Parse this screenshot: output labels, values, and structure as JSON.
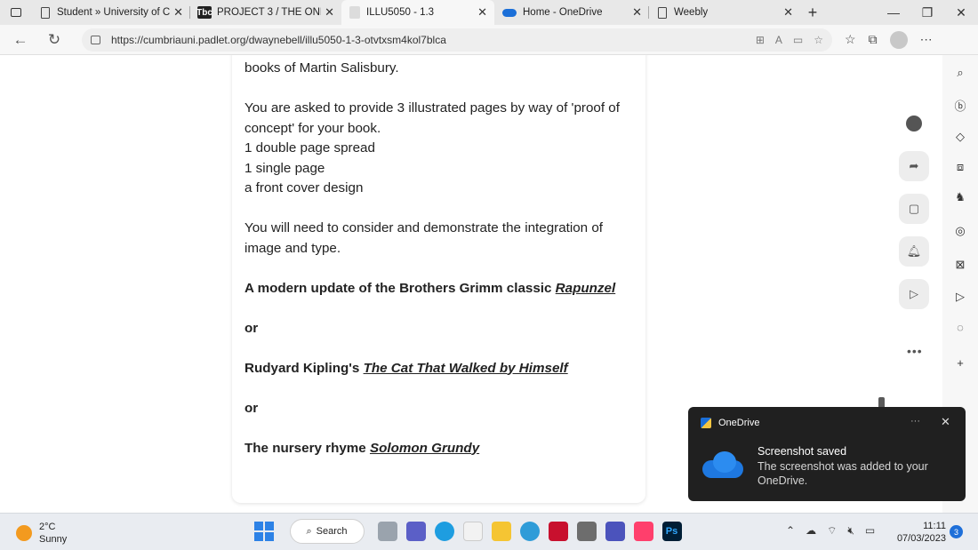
{
  "tabs": [
    {
      "label": "Student » University of Cu",
      "icon": "document-icon"
    },
    {
      "label": "PROJECT 3 / THE ONE WH",
      "icon": "weebly-icon",
      "icon_text": "Tbc"
    },
    {
      "label": "ILLU5050 - 1.3",
      "icon": "padlet-icon",
      "active": true
    },
    {
      "label": "Home - OneDrive",
      "icon": "onedrive-icon"
    },
    {
      "label": "Weebly",
      "icon": "document-icon"
    }
  ],
  "address": {
    "url": "https://cumbriauni.padlet.org/dwaynebell/illu5050-1-3-otvtxsm4kol7blca"
  },
  "post": {
    "line_top": "books of Martin Salisbury.",
    "para1": [
      "You are asked to provide 3 illustrated pages by way of 'proof of",
      "concept' for your book.",
      "1 double page spread",
      "1 single page",
      "a front cover design"
    ],
    "para2": [
      "You will need to consider and demonstrate the integration of",
      "image and type."
    ],
    "option1_prefix": "A modern update of the Brothers Grimm classic ",
    "option1_title": "Rapunzel",
    "or1": "or",
    "option2_prefix": "Rudyard Kipling's ",
    "option2_title": "The Cat That Walked by Himself",
    "or2": "or",
    "option3_prefix": "The nursery rhyme ",
    "option3_title": "Solomon Grundy"
  },
  "notification": {
    "app": "OneDrive",
    "title": "Screenshot saved",
    "body": "The screenshot was added to your OneDrive."
  },
  "taskbar": {
    "temp": "2°C",
    "condition": "Sunny",
    "search_label": "Search",
    "time": "11:11",
    "date": "07/03/2023",
    "badge": "3"
  },
  "colors": {
    "onedrive_blue": "#1e78e0",
    "accent": "#1e6fd9",
    "weather_sun": "#f39a1f"
  }
}
